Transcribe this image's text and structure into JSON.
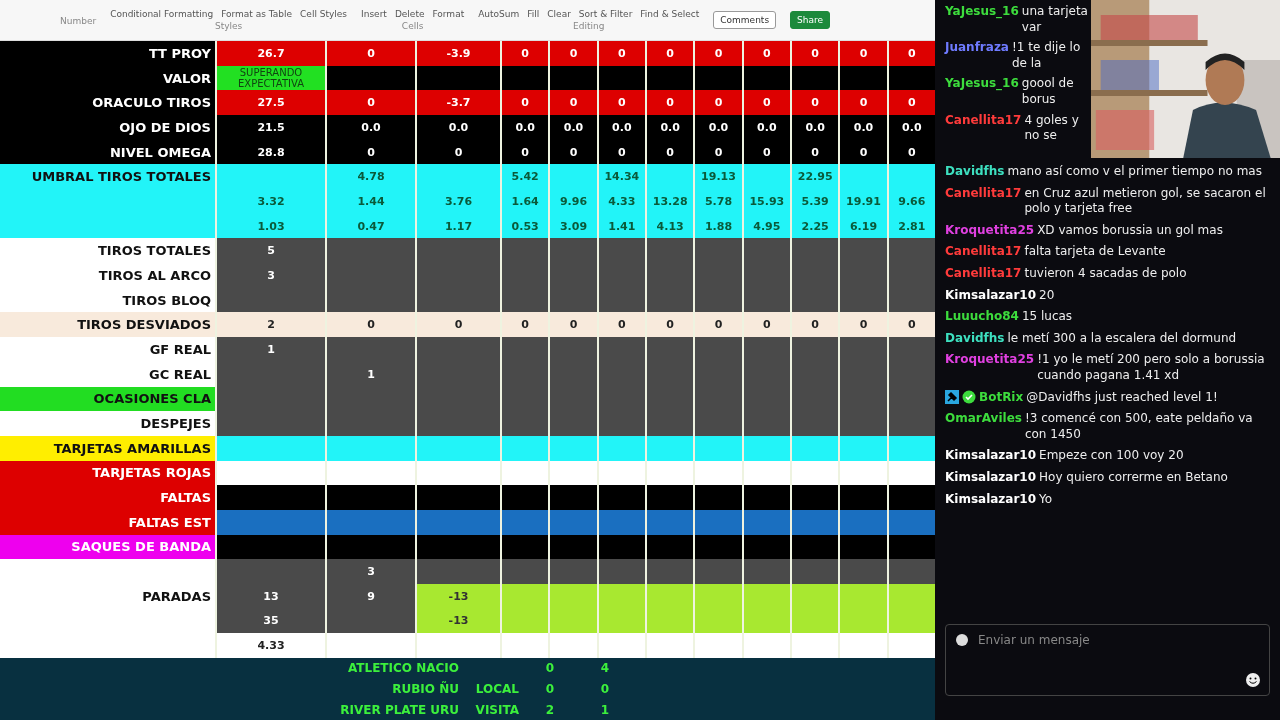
{
  "ribbon": {
    "groups": [
      {
        "name": "Number"
      },
      {
        "name": "Styles",
        "items": [
          "Conditional Formatting",
          "Format as Table",
          "Cell Styles"
        ]
      },
      {
        "name": "Cells",
        "items": [
          "Insert",
          "Delete",
          "Format"
        ]
      },
      {
        "name": "Editing",
        "items": [
          "AutoSum",
          "Fill",
          "Clear",
          "Sort & Filter",
          "Find & Select"
        ]
      }
    ],
    "buttons": [
      {
        "label": "Comments",
        "kind": "outline"
      },
      {
        "label": "Share",
        "kind": "accent"
      }
    ]
  },
  "sheet": {
    "rows": [
      {
        "label": "TT PROY",
        "kind": "red",
        "values": [
          "26.7",
          "0",
          "-3.9",
          "0",
          "0",
          "0",
          "0",
          "0",
          "0",
          "0",
          "0",
          "0"
        ]
      },
      {
        "label": "VALOR",
        "kind": "verdict",
        "values": [
          "SUPERANDO EXPECTATIVA"
        ]
      },
      {
        "label": "ORACULO TIROS",
        "kind": "red",
        "values": [
          "27.5",
          "0",
          "-3.7",
          "0",
          "0",
          "0",
          "0",
          "0",
          "0",
          "0",
          "0",
          "0"
        ]
      },
      {
        "label": "OJO DE DIOS",
        "kind": "plain",
        "values": [
          "21.5",
          "0.0",
          "0.0",
          "0.0",
          "0.0",
          "0.0",
          "0.0",
          "0.0",
          "0.0",
          "0.0",
          "0.0",
          "0.0"
        ]
      },
      {
        "label": "NIVEL OMEGA",
        "kind": "plain",
        "values": [
          "28.8",
          "0",
          "0",
          "0",
          "0",
          "0",
          "0",
          "0",
          "0",
          "0",
          "0",
          "0"
        ]
      },
      {
        "label": "UMBRAL TIROS TOTALES",
        "kind": "cyan",
        "values": {
          "column_2": "4.78",
          "column_4": "5.42",
          "column_6": "14.34",
          "column_8": "19.13",
          "column_10": "22.95"
        }
      },
      {
        "label": "",
        "kind": "cyan",
        "values": [
          "3.32",
          "1.44",
          "3.76",
          "1.64",
          "9.96",
          "4.33",
          "13.28",
          "5.78",
          "15.93",
          "5.39",
          "19.91",
          "9.66"
        ]
      },
      {
        "label": "",
        "kind": "cyan",
        "values": [
          "1.03",
          "0.47",
          "1.17",
          "0.53",
          "3.09",
          "1.41",
          "4.13",
          "1.88",
          "4.95",
          "2.25",
          "6.19",
          "2.81"
        ]
      },
      {
        "label": "TIROS TOTALES",
        "kind": "stat",
        "values": [
          "5"
        ]
      },
      {
        "label": "TIROS AL ARCO",
        "kind": "stat",
        "values": [
          "3"
        ]
      },
      {
        "label": "TIROS BLOQ",
        "kind": "stat",
        "values": []
      },
      {
        "label": "TIROS DESVIADOS",
        "kind": "beige",
        "color": "#f8eadc",
        "values": [
          "2",
          "0",
          "0",
          "0",
          "0",
          "0",
          "0",
          "0",
          "0",
          "0",
          "0",
          "0"
        ]
      },
      {
        "label": "GF REAL",
        "kind": "stat",
        "values": [
          "1"
        ]
      },
      {
        "label": "GC REAL",
        "kind": "stat",
        "values": {
          "column_2": "1"
        }
      },
      {
        "label": "OCASIONES CLA",
        "kind": "stat",
        "color": "#22dd22",
        "values": []
      },
      {
        "label": "DESPEJES",
        "kind": "stat",
        "values": []
      },
      {
        "label": "TARJETAS AMARILLAS",
        "kind": "cyan-band",
        "color": "#ffee00",
        "values": []
      },
      {
        "label": "TARJETAS ROJAS",
        "kind": "white",
        "color": "#dd0000",
        "values": []
      },
      {
        "label": "FALTAS",
        "kind": "dark",
        "color": "#dd0000",
        "values": []
      },
      {
        "label": "FALTAS EST",
        "kind": "blue-band",
        "color": "#dd0000",
        "values": []
      },
      {
        "label": "SAQUES DE BANDA",
        "kind": "dark",
        "color": "#ee00ee",
        "values": []
      },
      {
        "label": "",
        "kind": "stat",
        "values": {
          "column_2": "3"
        }
      },
      {
        "label": "PARADAS",
        "kind": "diff",
        "values": [
          "13",
          "9",
          "-13"
        ]
      },
      {
        "label": "",
        "kind": "diff",
        "values": {
          "column_1": "35",
          "column_3": "-13"
        }
      },
      {
        "label": "",
        "kind": "white",
        "values": [
          "4.33"
        ]
      }
    ]
  },
  "matches": [
    {
      "team": "ATLETICO NACIO",
      "home": "0",
      "away": "4"
    },
    {
      "team": "RUBIO ÑU",
      "side": "LOCAL",
      "home": "0",
      "away": "0"
    },
    {
      "team": "RIVER PLATE URU",
      "side": "VISITA",
      "home": "2",
      "away": "1"
    }
  ],
  "chat": {
    "messages": [
      {
        "user": "YaJesus_16",
        "color": "#3ddc3d",
        "text": "una tarjeta var"
      },
      {
        "user": "Juanfraza",
        "color": "#6f7bff",
        "text": "!1 te dije lo de la"
      },
      {
        "user": "YaJesus_16",
        "color": "#3ddc3d",
        "text": "goool de borus"
      },
      {
        "user": "Canellita17",
        "color": "#ff3b3b",
        "text": "4 goles y no se"
      },
      {
        "user": "Davidfhs",
        "color": "#3de0c0",
        "text": "mano así como v el primer tiempo no mas"
      },
      {
        "user": "Canellita17",
        "color": "#ff3b3b",
        "text": "en Cruz azul metieron gol, se sacaron el polo y tarjeta free"
      },
      {
        "user": "Kroquetita25",
        "color": "#e040e0",
        "text": "XD vamos borussia un gol mas"
      },
      {
        "user": "Canellita17",
        "color": "#ff3b3b",
        "text": "falta tarjeta de Levante"
      },
      {
        "user": "Canellita17",
        "color": "#ff3b3b",
        "text": "tuvieron 4 sacadas de polo"
      },
      {
        "user": "Kimsalazar10",
        "color": "#ffffff",
        "text": "20"
      },
      {
        "user": "Luuucho84",
        "color": "#3ddc3d",
        "text": "15 lucas"
      },
      {
        "user": "Davidfhs",
        "color": "#3de0c0",
        "text": "le metí 300 a la escalera del dormund"
      },
      {
        "user": "Kroquetita25",
        "color": "#e040e0",
        "text": "!1 yo le metí 200 pero solo a borussia cuando pagana 1.41 xd"
      },
      {
        "user": "BotRix",
        "color": "#3ddc3d",
        "badges": true,
        "text": "@Davidfhs just reached level 1!"
      },
      {
        "user": "OmarAviles",
        "color": "#3ddc3d",
        "text": "!3 comencé con 500, eate peldaño va con 1450"
      },
      {
        "user": "Kimsalazar10",
        "color": "#ffffff",
        "text": "Empeze con 100 voy 20"
      },
      {
        "user": "Kimsalazar10",
        "color": "#ffffff",
        "text": "Hoy quiero correrme en Betano"
      },
      {
        "user": "Kimsalazar10",
        "color": "#ffffff",
        "text": "Yo"
      }
    ],
    "placeholder": "Enviar un mensaje"
  }
}
